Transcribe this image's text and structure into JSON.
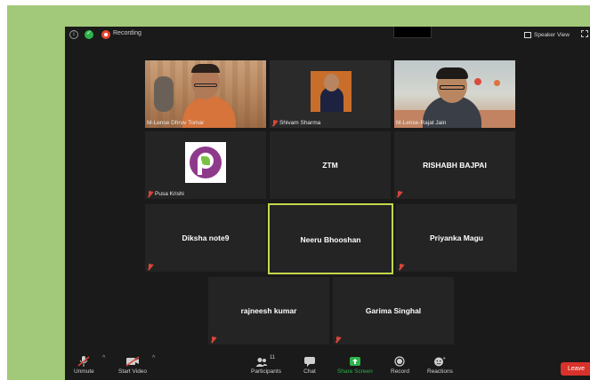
{
  "window": {
    "recording_label": "Recording",
    "speaker_view_label": "Speaker View"
  },
  "participants": [
    {
      "name": "",
      "label": "M-Lense Dhruv Tomar",
      "video": true,
      "muted": false
    },
    {
      "name": "",
      "label": "Shivam Sharma",
      "video": true,
      "muted": true
    },
    {
      "name": "",
      "label": "M-Lense-Rajat Jain",
      "video": true,
      "muted": false
    },
    {
      "name": "",
      "label": "Pusa Krishi",
      "video": true,
      "muted": true,
      "logo": "P"
    },
    {
      "name": "ZTM",
      "label": "",
      "video": false,
      "muted": false
    },
    {
      "name": "RISHABH BAJPAI",
      "label": "",
      "video": false,
      "muted": true
    },
    {
      "name": "Diksha note9",
      "label": "",
      "video": false,
      "muted": true
    },
    {
      "name": "Neeru Bhooshan",
      "label": "",
      "video": false,
      "muted": false,
      "active_speaker": true
    },
    {
      "name": "Priyanka Magu",
      "label": "",
      "video": false,
      "muted": true
    },
    {
      "name": "rajneesh kumar",
      "label": "",
      "video": false,
      "muted": true
    },
    {
      "name": "Garima Singhal",
      "label": "",
      "video": false,
      "muted": true
    }
  ],
  "toolbar": {
    "unmute_label": "Unmute",
    "start_video_label": "Start Video",
    "participants_label": "Participants",
    "participants_count": "11",
    "chat_label": "Chat",
    "share_screen_label": "Share Screen",
    "record_label": "Record",
    "reactions_label": "Reactions",
    "leave_label": "Leave"
  },
  "colors": {
    "frame_green": "#a2c879",
    "active_border": "#c4d74a",
    "share_green": "#2eb34b",
    "leave_red": "#d9322b",
    "mute_red": "#d9463b"
  }
}
